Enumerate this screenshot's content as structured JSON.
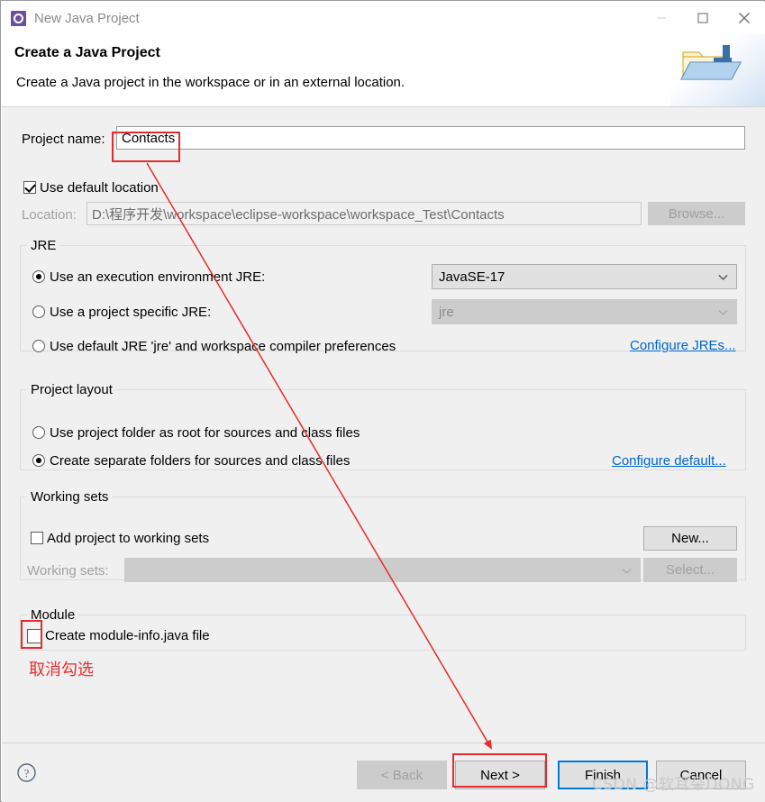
{
  "window": {
    "title": "New Java Project",
    "icon": "java-project-icon",
    "controls": {
      "minimize": "minimize-icon",
      "maximize": "maximize-icon",
      "close": "close-icon"
    }
  },
  "header": {
    "title": "Create a Java Project",
    "description": "Create a Java project in the workspace or in an external location.",
    "banner_icon": "open-folder-java-icon"
  },
  "form": {
    "project_name_label": "Project name:",
    "project_name_value": "Contacts",
    "use_default_location_label": "Use default location",
    "use_default_location_checked": true,
    "location_label": "Location:",
    "location_value": "D:\\程序开发\\workspace\\eclipse-workspace\\workspace_Test\\Contacts",
    "browse_button": "Browse..."
  },
  "jre": {
    "group_title": "JRE",
    "options": [
      {
        "label": "Use an execution environment JRE:",
        "selected": true
      },
      {
        "label": "Use a project specific JRE:",
        "selected": false
      },
      {
        "label": "Use default JRE 'jre' and workspace compiler preferences",
        "selected": false
      }
    ],
    "execution_environment_value": "JavaSE-17",
    "project_specific_jre_value": "jre",
    "configure_link": "Configure JREs..."
  },
  "project_layout": {
    "group_title": "Project layout",
    "options": [
      {
        "label": "Use project folder as root for sources and class files",
        "selected": false
      },
      {
        "label": "Create separate folders for sources and class files",
        "selected": true
      }
    ],
    "configure_link": "Configure default..."
  },
  "working_sets": {
    "group_title": "Working sets",
    "add_checkbox_label": "Add project to working sets",
    "add_checkbox_checked": false,
    "working_sets_label": "Working sets:",
    "working_sets_value": "",
    "new_button": "New...",
    "select_button": "Select..."
  },
  "module": {
    "group_title": "Module",
    "create_module_info_label": "Create module-info.java file",
    "create_module_info_checked": false
  },
  "footer": {
    "help_icon": "help-icon",
    "back_button": "< Back",
    "next_button": "Next >",
    "finish_button": "Finish",
    "cancel_button": "Cancel"
  },
  "annotations": {
    "uncheck_note": "取消勾选",
    "accent_color": "#e52b2b",
    "highlighted_project_name": true,
    "highlighted_module_checkbox": true,
    "highlighted_next_button": true
  },
  "watermark": {
    "text": "CSDN @软耳朵DONG"
  }
}
